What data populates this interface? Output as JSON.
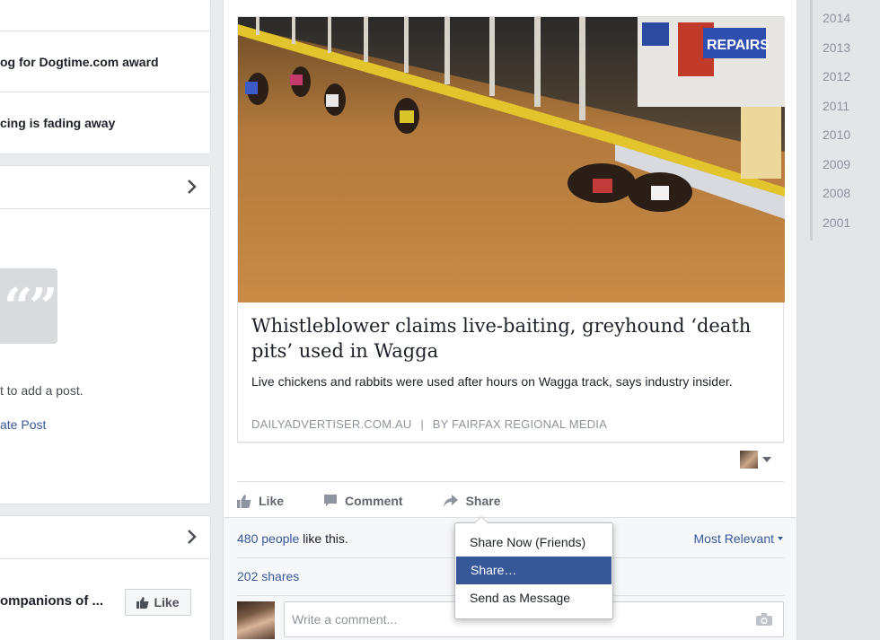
{
  "left": {
    "recent_posts": [
      {
        "title": ""
      },
      {
        "title": "og for Dogtime.com award"
      },
      {
        "title": "cing is fading away"
      }
    ],
    "posts_card": {
      "hint": "t to add a post.",
      "create_label": "ate Post"
    },
    "pages_card": {
      "page_name": "ompanions of ...",
      "like_label": "Like"
    }
  },
  "post": {
    "link": {
      "title": "Whistleblower claims live-baiting, greyhound ‘death pits’ used in Wagga",
      "description": "Live chickens and rabbits were used after hours on Wagga track, says industry insider.",
      "source": "DAILYADVERTISER.COM.AU",
      "separator": "|",
      "byline": "BY FAIRFAX REGIONAL MEDIA"
    },
    "photo_signs": {
      "sign_1": "REPAIRS"
    },
    "actions": {
      "like": "Like",
      "comment": "Comment",
      "share": "Share"
    },
    "summary": {
      "likes_count_link": "480 people",
      "likes_suffix": " like this.",
      "sort_label": "Most Relevant",
      "shares": "202 shares"
    },
    "comment_placeholder": "Write a comment..."
  },
  "share_menu": {
    "items": [
      "Share Now (Friends)",
      "Share…",
      "Send as Message"
    ],
    "active_index": 1
  },
  "year_rail": [
    "2014",
    "2013",
    "2012",
    "2011",
    "2010",
    "2009",
    "2008",
    "2001"
  ],
  "colors": {
    "link_blue": "#385898",
    "menu_active": "#365899",
    "page_bg": "#e9ebee"
  }
}
